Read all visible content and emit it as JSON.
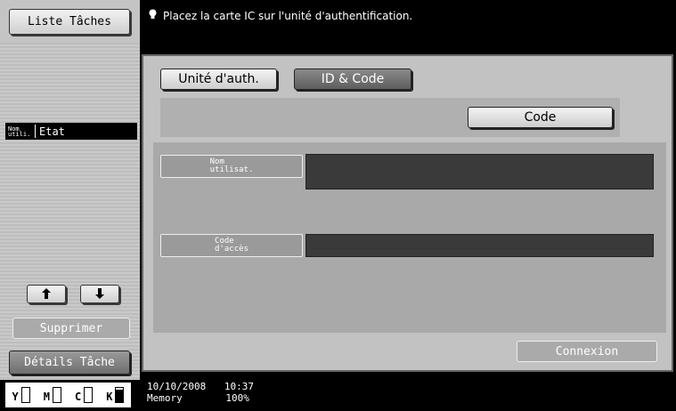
{
  "left_panel": {
    "job_list_button": "Liste Tâches",
    "col_user": "Nom\nutili.",
    "col_status": "Etat",
    "delete_button": "Supprimer",
    "details_button": "Détails Tâche",
    "toner": [
      {
        "label": "Y",
        "level": 0.0
      },
      {
        "label": "M",
        "level": 0.0
      },
      {
        "label": "C",
        "level": 0.0
      },
      {
        "label": "K",
        "level": 0.85
      }
    ]
  },
  "message": "Placez la carte IC sur l'unité d'authentification.",
  "tabs": {
    "auth_unit": "Unité d'auth.",
    "id_code": "ID & Code"
  },
  "code_button": "Code",
  "fields": {
    "username_label": "Nom\nutilisat.",
    "password_label": "Code\nd'accès",
    "username_value": "",
    "password_value": ""
  },
  "login_button": "Connexion",
  "status_bar": {
    "date": "10/10/2008",
    "time": "10:37",
    "memory_label": "Memory",
    "memory_value": "100%"
  }
}
